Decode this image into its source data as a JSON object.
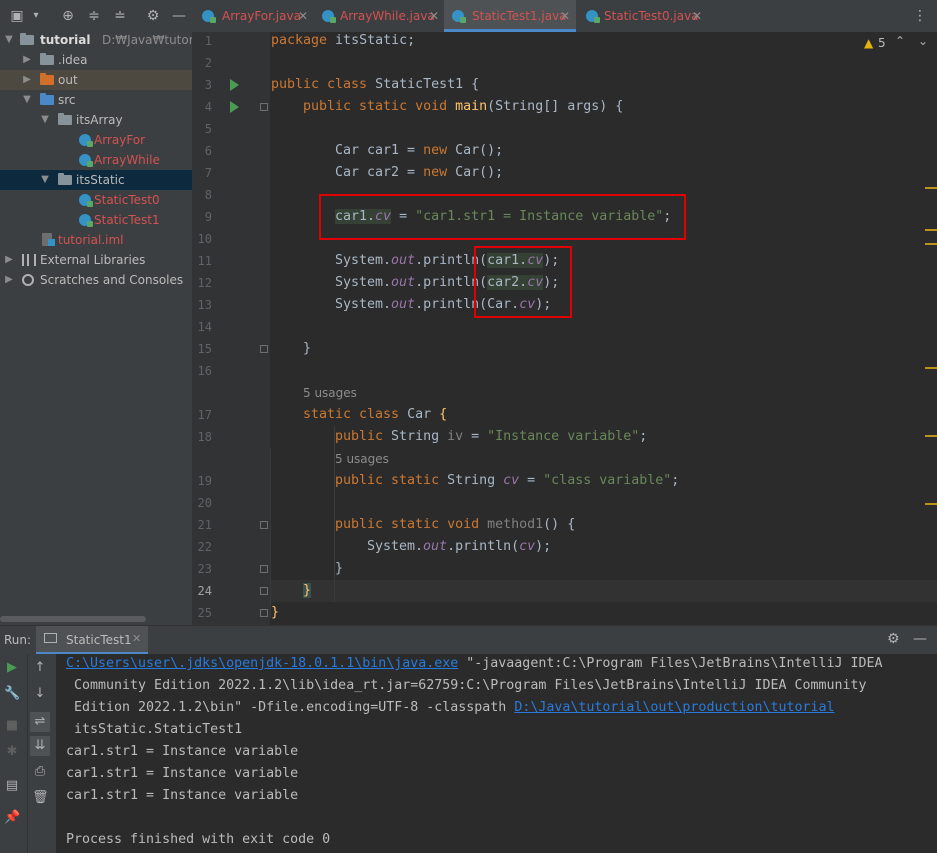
{
  "project": {
    "root_name": "tutorial",
    "root_path": "D:₩Java₩tutorial",
    "items": [
      {
        "label": "tutorial",
        "path": "D:₩Java₩tutorial"
      },
      {
        "label": ".idea"
      },
      {
        "label": "out"
      },
      {
        "label": "src"
      },
      {
        "label": "itsArray"
      },
      {
        "label": "ArrayFor"
      },
      {
        "label": "ArrayWhile"
      },
      {
        "label": "itsStatic"
      },
      {
        "label": "StaticTest0"
      },
      {
        "label": "StaticTest1"
      },
      {
        "label": "tutorial.iml"
      },
      {
        "label": "External Libraries"
      },
      {
        "label": "Scratches and Consoles"
      }
    ]
  },
  "tabs": [
    {
      "label": "ArrayFor.java"
    },
    {
      "label": "ArrayWhile.java"
    },
    {
      "label": "StaticTest1.java"
    },
    {
      "label": "StaticTest0.java"
    }
  ],
  "editor": {
    "warning_count": "5",
    "line_numbers": [
      "1",
      "2",
      "3",
      "4",
      "5",
      "6",
      "7",
      "8",
      "9",
      "10",
      "11",
      "12",
      "13",
      "14",
      "15",
      "16",
      "17",
      "18",
      "19",
      "20",
      "21",
      "22",
      "23",
      "24",
      "25"
    ],
    "usages_1": "5 usages",
    "usages_2": "5 usages",
    "code": {
      "l1_kw": "package",
      "l1_rest": " itsStatic;",
      "l3_kw": "public class",
      "l3_rest": " StaticTest1 {",
      "l4_kw": "public static void",
      "l4_fn": "main",
      "l4_rest": "(String[] args) {",
      "l6_a": "Car car1 = ",
      "l6_kw": "new",
      "l6_b": " Car();",
      "l7_a": "Car car2 = ",
      "l7_kw": "new",
      "l7_b": " Car();",
      "l9_obj": "car1",
      "l9_dot": ".",
      "l9_fld": "cv",
      "l9_eq": " = ",
      "l9_str": "\"car1.str1 = Instance variable\"",
      "l9_end": ";",
      "l11_a": "System.",
      "l11_out": "out",
      "l11_b": ".println(",
      "l11_obj": "car1",
      "l11_dot": ".",
      "l11_fld": "cv",
      "l11_end": ");",
      "l12_a": "System.",
      "l12_out": "out",
      "l12_b": ".println(",
      "l12_obj": "car2",
      "l12_dot": ".",
      "l12_fld": "cv",
      "l12_end": ");",
      "l13_a": "System.",
      "l13_out": "out",
      "l13_b": ".println(",
      "l13_obj": "Car",
      "l13_dot": ".",
      "l13_fld": "cv",
      "l13_end": ");",
      "l15": "}",
      "l17_kw": "static class",
      "l17_rest": " Car ",
      "l17_brace": "{",
      "l18_kw": "public",
      "l18_a": " String ",
      "l18_fld": "iv",
      "l18_eq": " = ",
      "l18_str": "\"Instance variable\"",
      "l18_end": ";",
      "l19_kw": "public static",
      "l19_a": " String ",
      "l19_fld": "cv",
      "l19_eq": " = ",
      "l19_str": "\"class variable\"",
      "l19_end": ";",
      "l21_kw": "public static void",
      "l21_fn": "method1",
      "l21_rest": "() {",
      "l22_a": "System.",
      "l22_out": "out",
      "l22_b": ".println(",
      "l22_fld": "cv",
      "l22_end": ");",
      "l23": "}",
      "l24": "}",
      "l25": "}"
    }
  },
  "run": {
    "label": "Run:",
    "tab": "StaticTest1",
    "console": {
      "line1_link": "C:\\Users\\user\\.jdks\\openjdk-18.0.1.1\\bin\\java.exe",
      "line1_rest": " \"-javaagent:C:\\Program Files\\JetBrains\\IntelliJ IDEA",
      "line2": " Community Edition 2022.1.2\\lib\\idea_rt.jar=62759:C:\\Program Files\\JetBrains\\IntelliJ IDEA Community",
      "line3_a": " Edition 2022.1.2\\bin\" -Dfile.encoding=UTF-8 -classpath ",
      "line3_link": "D:\\Java\\tutorial\\out\\production\\tutorial",
      "line4": " itsStatic.StaticTest1",
      "out1": "car1.str1 = Instance variable",
      "out2": "car1.str1 = Instance variable",
      "out3": "car1.str1 = Instance variable",
      "exit": "Process finished with exit code 0"
    }
  },
  "colors": {
    "keyword": "#cc7832",
    "string": "#6a8759",
    "field": "#9876aa",
    "function": "#ffc66d",
    "link": "#287bde",
    "highlight_box": "#e00000"
  }
}
